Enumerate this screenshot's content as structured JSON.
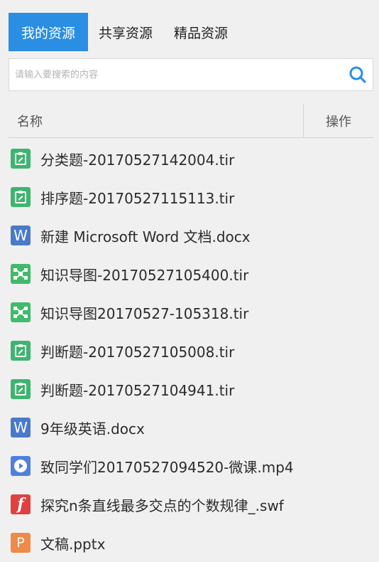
{
  "tabs": [
    {
      "label": "我的资源",
      "active": true
    },
    {
      "label": "共享资源",
      "active": false
    },
    {
      "label": "精品资源",
      "active": false
    }
  ],
  "search": {
    "placeholder": "请输入要搜索的内容",
    "icon": "search-icon"
  },
  "table": {
    "col_name": "名称",
    "col_action": "操作"
  },
  "files": [
    {
      "name": "分类题-20170527142004.tir",
      "icon": "tir-question-icon",
      "color": "#3db56f"
    },
    {
      "name": "排序题-20170527115113.tir",
      "icon": "tir-question-icon",
      "color": "#3db56f"
    },
    {
      "name": "新建 Microsoft Word 文档.docx",
      "icon": "word-icon",
      "color": "#4a7ac9"
    },
    {
      "name": "知识导图-20170527105400.tir",
      "icon": "mindmap-icon",
      "color": "#41bb6b"
    },
    {
      "name": "知识导图20170527-105318.tir",
      "icon": "mindmap-icon",
      "color": "#41bb6b"
    },
    {
      "name": "判断题-20170527105008.tir",
      "icon": "tir-question-icon",
      "color": "#3db56f"
    },
    {
      "name": "判断题-20170527104941.tir",
      "icon": "tir-question-icon",
      "color": "#3db56f"
    },
    {
      "name": "9年级英语.docx",
      "icon": "word-icon",
      "color": "#4a7ac9"
    },
    {
      "name": "致同学们20170527094520-微课.mp4",
      "icon": "video-icon",
      "color": "#4f80e0"
    },
    {
      "name": "探究n条直线最多交点的个数规律_.swf",
      "icon": "flash-icon",
      "color": "#e04040"
    },
    {
      "name": "文稿.pptx",
      "icon": "powerpoint-icon",
      "color": "#ef8a48"
    }
  ]
}
